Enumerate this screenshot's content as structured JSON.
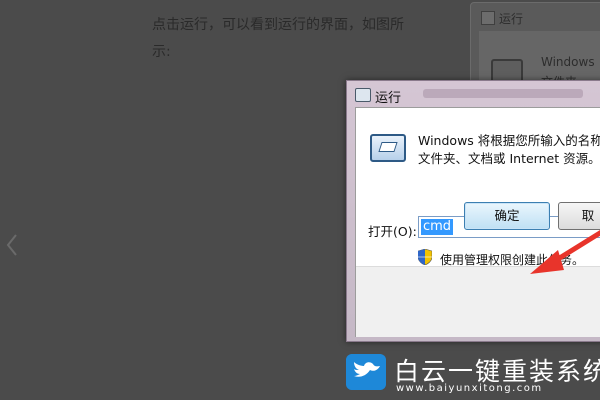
{
  "article": {
    "line1": "点击运行，可以看到运行的界面，如图所",
    "line2": "示:"
  },
  "background_dialog": {
    "title": "运行",
    "text1": "Windows",
    "text2": "文件夹、"
  },
  "dialog": {
    "title": "运行",
    "description_line1": "Windows 将根据您所输入的名称，",
    "description_line2": "文件夹、文档或 Internet 资源。",
    "open_label": "打开(O):",
    "open_value": "cmd",
    "admin_note": "使用管理权限创建此任务。",
    "ok_label": "确定",
    "cancel_label": "取"
  },
  "watermark": {
    "name": "白云一键重装系统",
    "url": "www.baiyunxitong.com"
  },
  "colors": {
    "selection": "#3399ff",
    "arrow": "#e8342b",
    "brand_blue": "#1e88d8"
  }
}
